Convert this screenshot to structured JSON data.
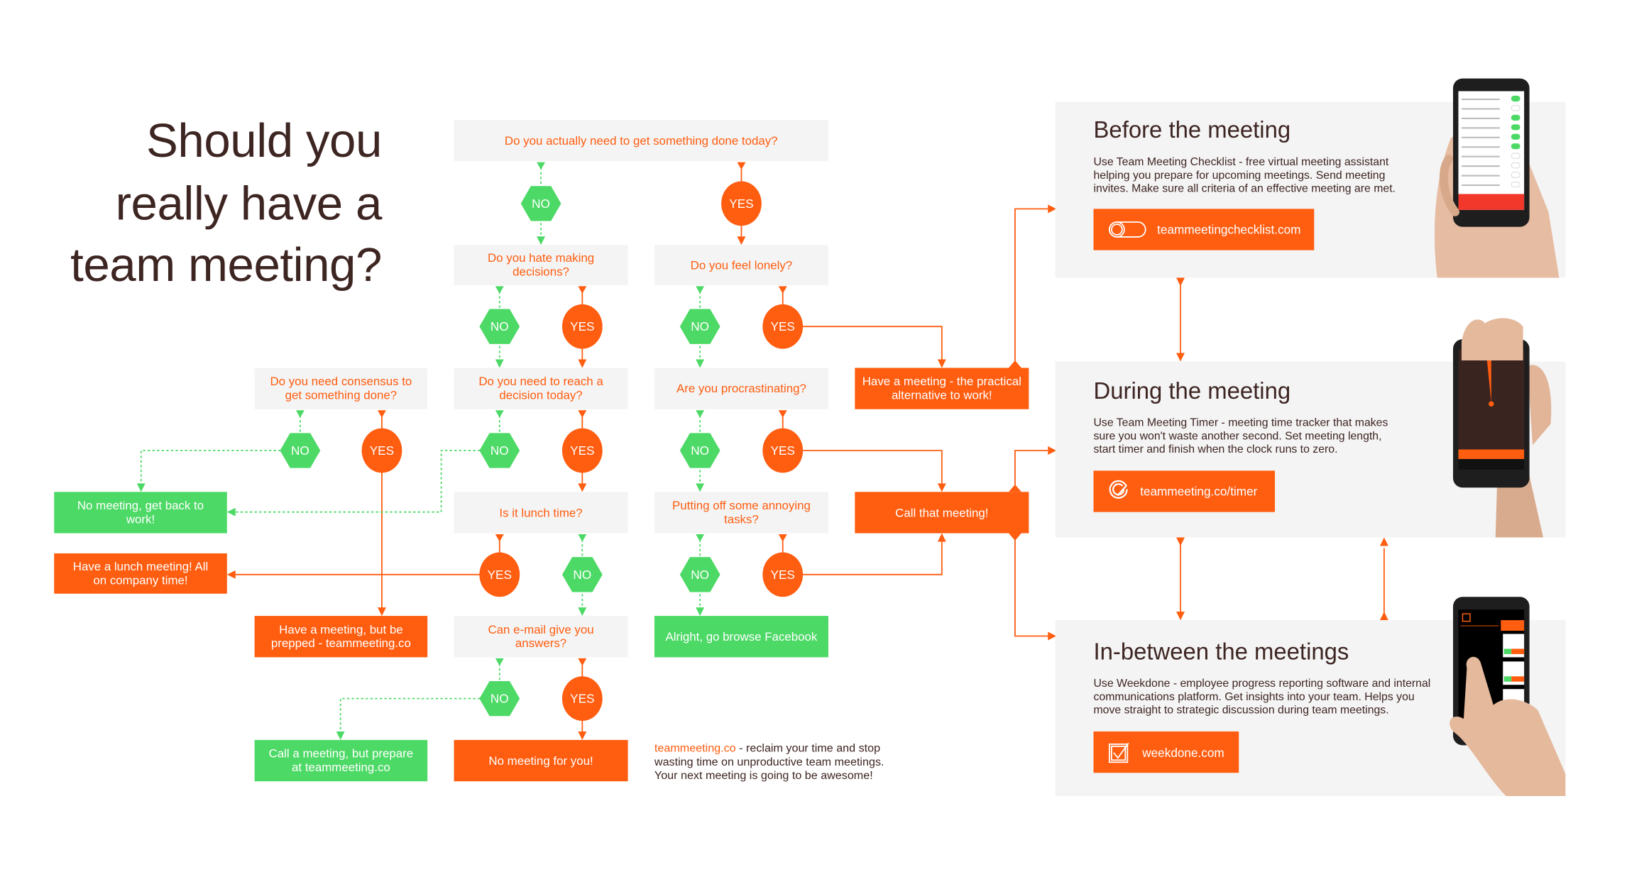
{
  "title": {
    "lines": [
      "Should you",
      "really have a",
      "team meeting?"
    ]
  },
  "colors": {
    "accent_orange": "#ff5d10",
    "accent_green": "#4dd966",
    "box_gray": "#f4f4f4",
    "text_dark": "#3d2522"
  },
  "labels": {
    "yes": "YES",
    "no": "NO"
  },
  "questions": {
    "q_done_today": [
      "Do you actually need to get something done today?"
    ],
    "q_hate_decisions": [
      "Do you hate making",
      "decisions?"
    ],
    "q_lonely": [
      "Do you feel lonely?"
    ],
    "q_consensus": [
      "Do you need consensus to",
      "get something done?"
    ],
    "q_reach_decision": [
      "Do you need to reach a",
      "decision today?"
    ],
    "q_procrastinating": [
      "Are you procrastinating?"
    ],
    "q_lunch": [
      "Is it lunch time?"
    ],
    "q_annoying": [
      "Putting off some annoying",
      "tasks?"
    ],
    "q_email": [
      "Can e-mail give you",
      "answers?"
    ]
  },
  "outcomes": {
    "have_meeting_alt": [
      "Have a meeting - the practical",
      "alternative to work!"
    ],
    "call_that_meeting": [
      "Call that meeting!"
    ],
    "no_meeting_back_to_work": [
      "No meeting, get back to",
      "work!"
    ],
    "lunch_meeting": [
      "Have a lunch meeting! All",
      "on company time!"
    ],
    "meeting_prepped": [
      "Have a meeting, but be",
      "prepped - teammeeting.co"
    ],
    "browse_facebook": [
      "Alright, go browse Facebook"
    ],
    "call_prepare": [
      "Call a meeting, but prepare",
      "at teammeeting.co"
    ],
    "no_meeting_for_you": [
      "No meeting for you!"
    ]
  },
  "footer": {
    "link": "teammeeting.co",
    "line1_rest": " - reclaim your time and stop",
    "line2": "wasting time on unproductive team meetings.",
    "line3": "Your next meeting is going to be awesome!"
  },
  "panels": [
    {
      "title": "Before the meeting",
      "description": [
        "Use Team Meeting Checklist - free virtual meeting assistant",
        "helping you prepare for upcoming meetings. Send meeting",
        "invites. Make sure all criteria of an effective meeting are met."
      ],
      "link_label": "teammeetingchecklist.com",
      "icon": "toggle-icon"
    },
    {
      "title": "During the meeting",
      "description": [
        "Use Team Meeting Timer - meeting time tracker that makes",
        "sure you won't waste another second. Set meeting length,",
        "start timer and finish when the clock runs to zero."
      ],
      "link_label": "teammeeting.co/timer",
      "icon": "timer-icon"
    },
    {
      "title": "In-between the meetings",
      "description": [
        "Use Weekdone - employee progress reporting software and internal",
        "communications platform. Get insights into your team. Helps you",
        "move straight to strategic discussion during team meetings."
      ],
      "link_label": "weekdone.com",
      "icon": "checklist-icon"
    }
  ]
}
